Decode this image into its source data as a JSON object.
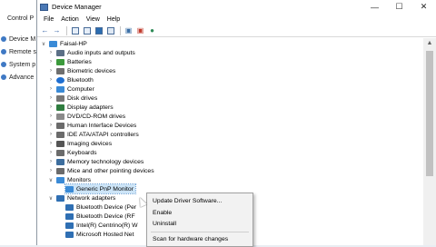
{
  "background_window": {
    "breadcrumb": "Control P",
    "links": [
      "Device M",
      "Remote s",
      "System p",
      "Advance"
    ],
    "link_color": "#3f79c4"
  },
  "window": {
    "title": "Device Manager",
    "controls": {
      "minimize": "—",
      "maximize": "☐",
      "close": "✕"
    }
  },
  "menubar": {
    "items": [
      "File",
      "Action",
      "View",
      "Help"
    ]
  },
  "toolbar": {
    "icons": [
      "back-arrow-icon",
      "forward-arrow-icon",
      "properties-icon",
      "show-hidden-icon",
      "help-icon",
      "display-icon",
      "scan-icon",
      "disable-icon",
      "update-icon"
    ]
  },
  "tree": {
    "root": "Faisal-HP",
    "categories": [
      {
        "label": "Audio inputs and outputs",
        "icon": "audio-icon",
        "color": "#5b6f86"
      },
      {
        "label": "Batteries",
        "icon": "battery-icon",
        "color": "#3c9a3c"
      },
      {
        "label": "Biometric devices",
        "icon": "biometric-icon",
        "color": "#6f6f6f"
      },
      {
        "label": "Bluetooth",
        "icon": "bluetooth-icon",
        "color": "#1f6fd1"
      },
      {
        "label": "Computer",
        "icon": "computer-icon",
        "color": "#3a8ad6"
      },
      {
        "label": "Disk drives",
        "icon": "disk-icon",
        "color": "#777777"
      },
      {
        "label": "Display adapters",
        "icon": "display-adapter-icon",
        "color": "#2f7d3f"
      },
      {
        "label": "DVD/CD-ROM drives",
        "icon": "dvd-icon",
        "color": "#8a8a8a"
      },
      {
        "label": "Human Interface Devices",
        "icon": "hid-icon",
        "color": "#6b6b6b"
      },
      {
        "label": "IDE ATA/ATAPI controllers",
        "icon": "ide-icon",
        "color": "#6b6b6b"
      },
      {
        "label": "Imaging devices",
        "icon": "camera-icon",
        "color": "#555555"
      },
      {
        "label": "Keyboards",
        "icon": "keyboard-icon",
        "color": "#6b6b6b"
      },
      {
        "label": "Memory technology devices",
        "icon": "memory-icon",
        "color": "#3d6e9e"
      },
      {
        "label": "Mice and other pointing devices",
        "icon": "mouse-icon",
        "color": "#6b6b6b"
      },
      {
        "label": "Monitors",
        "icon": "monitor-icon",
        "color": "#3a8ad6"
      }
    ],
    "monitor_child": "Generic PnP Monitor",
    "network": {
      "label": "Network adapters",
      "children": [
        "Bluetooth Device (Per",
        "Bluetooth Device (RF",
        "Intel(R) Centrino(R) W",
        "Microsoft Hosted Net"
      ]
    }
  },
  "context_menu": {
    "items": [
      "Update Driver Software...",
      "Enable",
      "Uninstall",
      "Scan for hardware changes"
    ]
  }
}
